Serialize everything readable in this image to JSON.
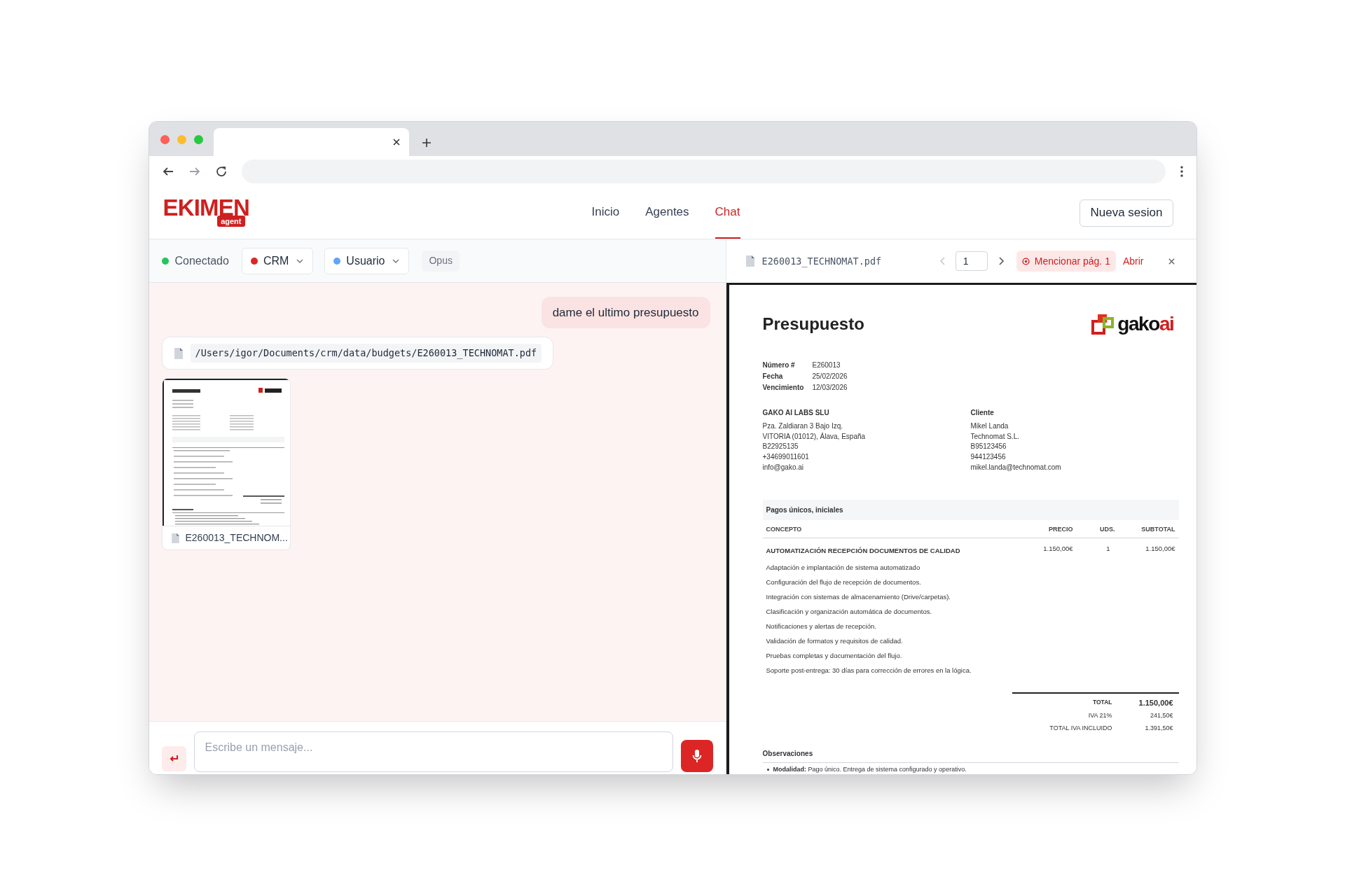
{
  "app": {
    "logo": "EKIMEN",
    "logo_badge": "agent"
  },
  "nav": [
    {
      "label": "Inicio",
      "selected": false
    },
    {
      "label": "Agentes",
      "selected": false
    },
    {
      "label": "Chat",
      "selected": true
    }
  ],
  "new_session_button": "Nueva sesion",
  "toolbar": {
    "connection": {
      "label": "Conectado",
      "connected": true
    },
    "selectors": [
      {
        "label": "CRM",
        "color": "#dc2626"
      },
      {
        "label": "Usuario",
        "color": "#60a5fa"
      }
    ],
    "model_badge": "Opus"
  },
  "chat": {
    "messages": [
      {
        "kind": "user",
        "text": "dame el ultimo presupuesto"
      },
      {
        "kind": "file_path",
        "path": "/Users/igor/Documents/crm/data/budgets/E260013_TECHNOMAT.pdf"
      },
      {
        "kind": "attachment",
        "name": "E260013_TECHNOM..."
      }
    ],
    "input": {
      "placeholder": "Escribe un mensaje..."
    }
  },
  "viewer": {
    "filename": "E260013_TECHNOMAT.pdf",
    "page": "1",
    "mention_button": "Mencionar pág. 1",
    "open_link": "Abrir",
    "document": {
      "title": "Presupuesto",
      "logo_text": "gako",
      "logo_accent": "ai",
      "meta": [
        {
          "label": "Número #",
          "value": "E260013"
        },
        {
          "label": "Fecha",
          "value": "25/02/2026"
        },
        {
          "label": "Vencimiento",
          "value": "12/03/2026"
        }
      ],
      "issuer": {
        "heading": "GAKO AI LABS SLU",
        "lines": [
          "Pza. Zaldiaran 3 Bajo Izq.",
          "VITORIA (01012), Álava, España",
          "B22925135",
          "+34699011601",
          "info@gako.ai"
        ]
      },
      "client": {
        "heading": "Cliente",
        "lines": [
          "Mikel Landa",
          "Technomat S.L.",
          "B95123456",
          "944123456",
          "mikel.landa@technomat.com"
        ]
      },
      "section": "Pagos únicos, iniciales",
      "columns": [
        "CONCEPTO",
        "PRECIO",
        "UDS.",
        "SUBTOTAL"
      ],
      "item": {
        "title": "AUTOMATIZACIÓN RECEPCIÓN DOCUMENTOS DE CALIDAD",
        "price": "1.150,00€",
        "units": "1",
        "subtotal": "1.150,00€",
        "lines": [
          "Adaptación e implantación de sistema automatizado",
          "Configuración del flujo de recepción de documentos.",
          "Integración con sistemas de almacenamiento (Drive/carpetas).",
          "Clasificación y organización automática de documentos.",
          "Notificaciones y alertas de recepción.",
          "Validación de formatos y requisitos de calidad.",
          "Pruebas completas y documentación del flujo.",
          "Soporte post-entrega: 30 días para corrección de errores en la lógica."
        ]
      },
      "totals": [
        {
          "kind": "grand",
          "label": "TOTAL",
          "value": "1.150,00€"
        },
        {
          "kind": "normal",
          "label": "IVA 21%",
          "value": "241,50€"
        },
        {
          "kind": "normal",
          "label": "TOTAL IVA INCLUIDO",
          "value": "1.391,50€"
        }
      ],
      "observations": "Observaciones",
      "notes": [
        "**Modalidad:** Pago único. Entrega de sistema configurado y operativo."
      ]
    }
  }
}
